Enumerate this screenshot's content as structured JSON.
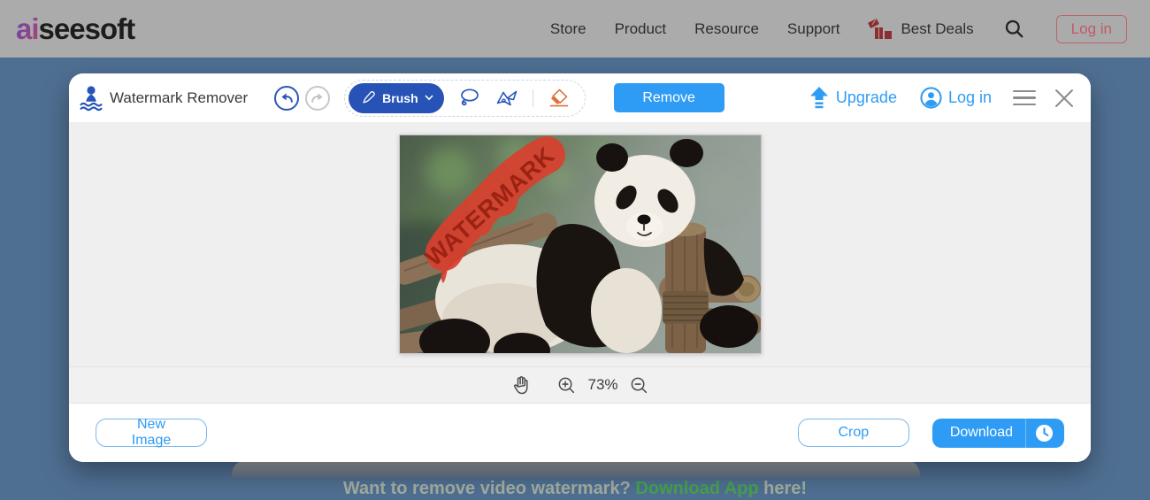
{
  "top_nav": {
    "logo_text_accent": "ai",
    "logo_text_rest": "seesoft",
    "items": [
      {
        "label": "Store"
      },
      {
        "label": "Product"
      },
      {
        "label": "Resource"
      },
      {
        "label": "Support"
      },
      {
        "label": "Best Deals"
      }
    ],
    "login_label": "Log in"
  },
  "modal": {
    "title": "Watermark Remover",
    "toolbar": {
      "brush_label": "Brush",
      "remove_label": "Remove"
    },
    "account": {
      "upgrade_label": "Upgrade",
      "login_label": "Log in"
    },
    "canvas": {
      "watermark_text": "WATERMARK"
    },
    "zoom_bar": {
      "zoom_level": "73%"
    },
    "footer": {
      "new_image_label": "New Image",
      "crop_label": "Crop",
      "download_label": "Download"
    }
  },
  "background_page": {
    "promo_prefix": "Want to remove video watermark? ",
    "promo_link": "Download App",
    "promo_suffix": " here!"
  },
  "colors": {
    "accent_blue": "#2e9cf4",
    "deep_blue": "#2653b5",
    "eraser_orange": "#e0703a",
    "watermark_red": "#d8402e",
    "page_background": "#4f6f92"
  }
}
